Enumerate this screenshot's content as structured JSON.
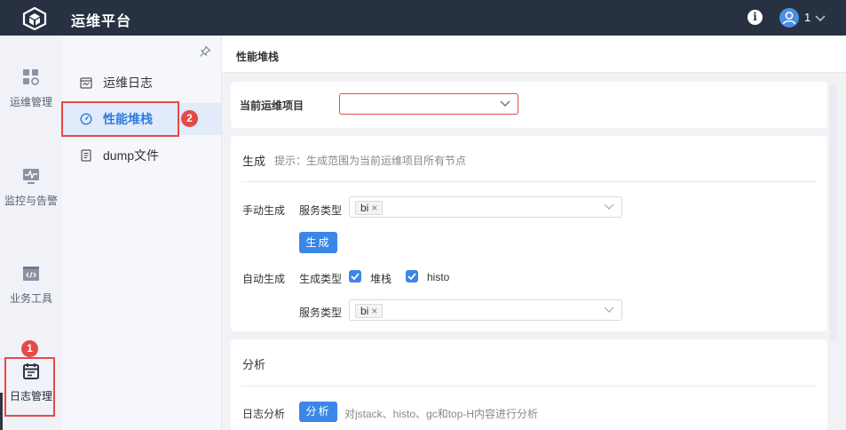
{
  "app": {
    "title": "运维平台",
    "user_name": "1"
  },
  "nav_primary": [
    {
      "label": "运维管理",
      "icon": "apps-grid-icon"
    },
    {
      "label": "监控与告警",
      "icon": "monitor-icon"
    },
    {
      "label": "业务工具",
      "icon": "code-window-icon"
    },
    {
      "label": "日志管理",
      "icon": "log-calendar-icon",
      "active": true
    }
  ],
  "nav_secondary": [
    {
      "label": "运维日志",
      "icon": "calendar-icon"
    },
    {
      "label": "性能堆栈",
      "icon": "gauge-icon",
      "active": true
    },
    {
      "label": "dump文件",
      "icon": "document-icon"
    }
  ],
  "annotations": {
    "badge_1": "1",
    "badge_2": "2"
  },
  "page": {
    "title": "性能堆栈",
    "project": {
      "label": "当前运维项目",
      "value": ""
    },
    "generate": {
      "title": "生成",
      "hint": "提示：生成范围为当前运维项目所有节点",
      "manual_label": "手动生成",
      "service_type_label": "服务类型",
      "service_tag": "bi",
      "generate_button": "生成",
      "auto_label": "自动生成",
      "gen_type_label": "生成类型",
      "gen_types": [
        "堆栈",
        "histo"
      ],
      "auto_service_type_label": "服务类型",
      "auto_service_tag": "bi"
    },
    "analyze": {
      "title": "分析",
      "log_label": "日志分析",
      "button": "分析",
      "hint": "对jstack、histo、gc和top-H内容进行分析"
    }
  },
  "colors": {
    "topbar": "#273142",
    "primary": "#3b87e8",
    "annotation": "#e64949"
  }
}
